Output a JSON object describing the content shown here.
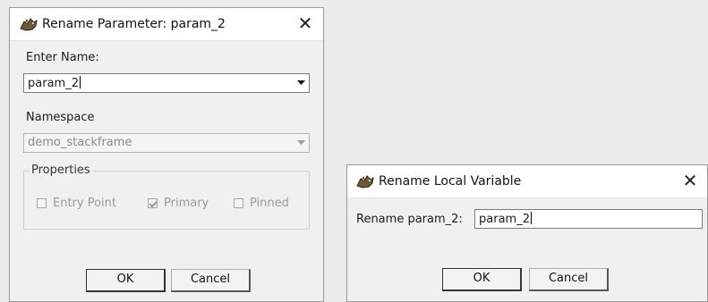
{
  "rename_parameter": {
    "title": "Rename Parameter: param_2",
    "enter_name_label": "Enter Name:",
    "name_value": "param_2",
    "namespace_label": "Namespace",
    "namespace_value": "demo_stackframe",
    "properties_label": "Properties",
    "entry_point_label": "Entry Point",
    "primary_label": "Primary",
    "pinned_label": "Pinned",
    "ok_label": "OK",
    "cancel_label": "Cancel"
  },
  "rename_local_variable": {
    "title": "Rename Local Variable",
    "field_label": "Rename param_2:",
    "field_value": "param_2",
    "ok_label": "OK",
    "cancel_label": "Cancel"
  },
  "icons": {
    "app": "dragon-icon",
    "close": "close-icon",
    "dropdown": "chevron-down-icon"
  }
}
